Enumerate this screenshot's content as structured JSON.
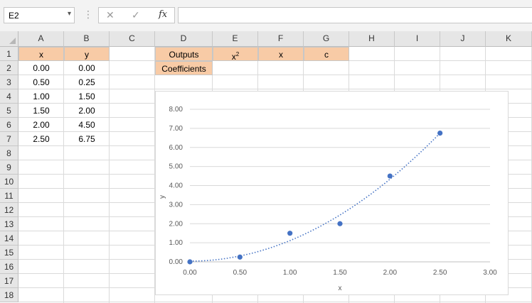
{
  "formula_bar": {
    "name_box": "E2",
    "cancel_icon": "✕",
    "enter_icon": "✓",
    "fx_label": "fx",
    "formula": ""
  },
  "columns": [
    "A",
    "B",
    "C",
    "D",
    "E",
    "F",
    "G",
    "H",
    "I",
    "J",
    "K"
  ],
  "rows": [
    "1",
    "2",
    "3",
    "4",
    "5",
    "6",
    "7",
    "8",
    "9",
    "10",
    "11",
    "12",
    "13",
    "14",
    "15",
    "16",
    "17",
    "18"
  ],
  "table": {
    "header_x": "x",
    "header_y": "y",
    "data": [
      {
        "x": "0.00",
        "y": "0.00"
      },
      {
        "x": "0.50",
        "y": "0.25"
      },
      {
        "x": "1.00",
        "y": "1.50"
      },
      {
        "x": "1.50",
        "y": "2.00"
      },
      {
        "x": "2.00",
        "y": "4.50"
      },
      {
        "x": "2.50",
        "y": "6.75"
      }
    ]
  },
  "outputs": {
    "label": "Outputs",
    "col_x2": "x",
    "col_x2_sup": "2",
    "col_x": "x",
    "col_c": "c",
    "coefficients": "Coefficients"
  },
  "colors": {
    "header_fill": "#f8cba6",
    "marker": "#4472c4"
  },
  "chart_data": {
    "type": "scatter",
    "xlabel": "x",
    "ylabel": "y",
    "xlim": [
      0,
      3
    ],
    "ylim": [
      0,
      8
    ],
    "xticks": [
      "0.00",
      "0.50",
      "1.00",
      "1.50",
      "2.00",
      "2.50",
      "3.00"
    ],
    "yticks": [
      "0.00",
      "1.00",
      "2.00",
      "3.00",
      "4.00",
      "5.00",
      "6.00",
      "7.00",
      "8.00"
    ],
    "grid": "horizontal",
    "trendline": "polynomial (dotted)",
    "series": [
      {
        "x": [
          0,
          0.5,
          1.0,
          1.5,
          2.0,
          2.5
        ],
        "y": [
          0,
          0.25,
          1.5,
          2.0,
          4.5,
          6.75
        ]
      }
    ]
  }
}
